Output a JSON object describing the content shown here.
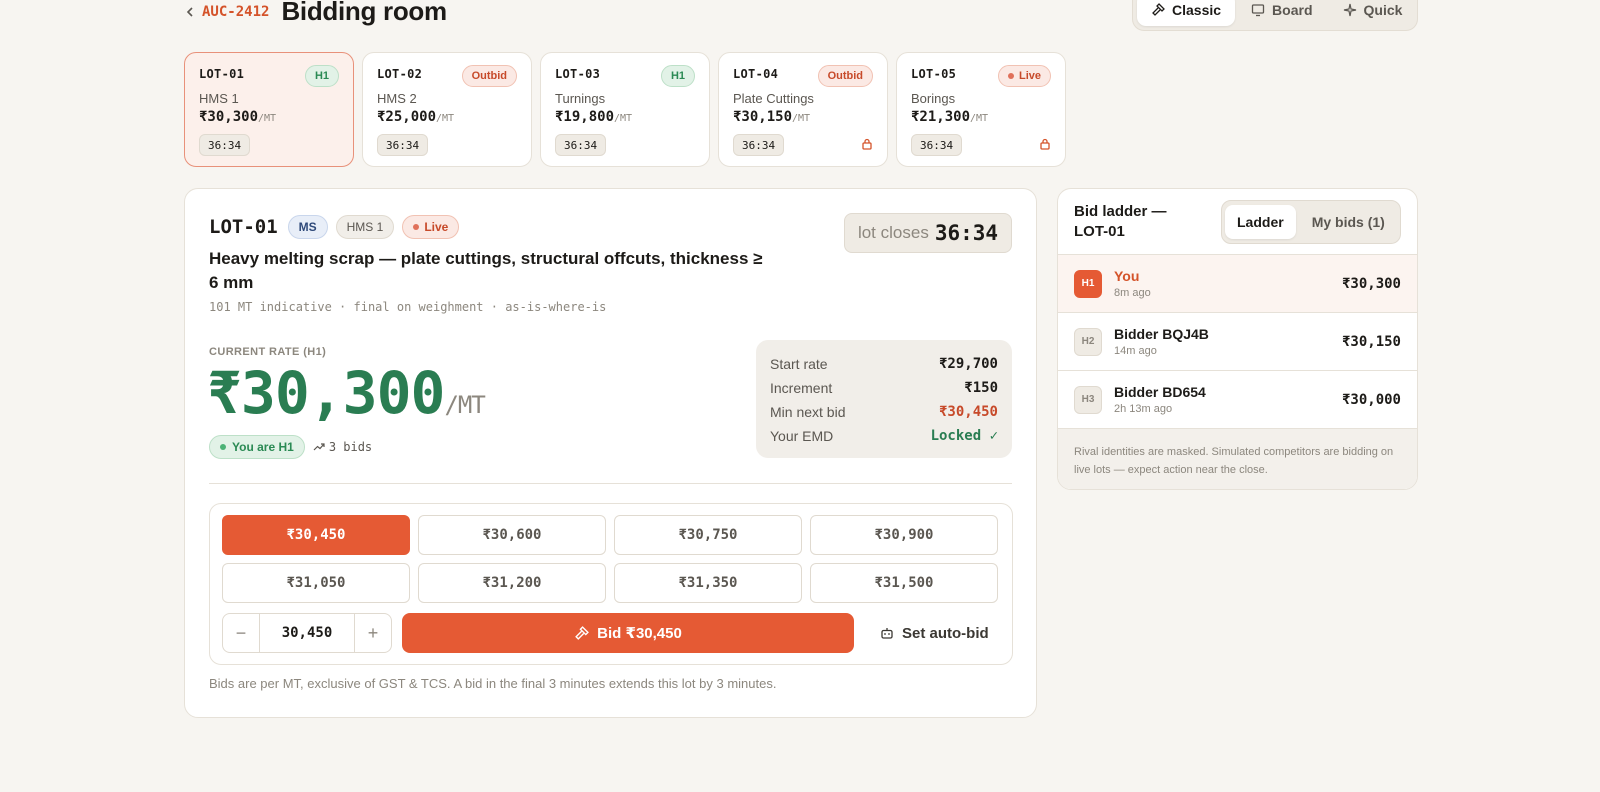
{
  "header": {
    "auction_id": "AUC-2412",
    "title": "Bidding room"
  },
  "modes": [
    {
      "label": "Classic",
      "icon": "gavel-icon",
      "active": true
    },
    {
      "label": "Board",
      "icon": "monitor-icon",
      "active": false
    },
    {
      "label": "Quick",
      "icon": "sparkle-icon",
      "active": false
    }
  ],
  "lots": [
    {
      "id": "LOT-01",
      "badge": "H1",
      "name": "HMS 1",
      "price": "₹30,300",
      "unit": "/MT",
      "timer": "36:34"
    },
    {
      "id": "LOT-02",
      "badge": "Outbid",
      "name": "HMS 2",
      "price": "₹25,000",
      "unit": "/MT",
      "timer": "36:34"
    },
    {
      "id": "LOT-03",
      "badge": "H1",
      "name": "Turnings",
      "price": "₹19,800",
      "unit": "/MT",
      "timer": "36:34"
    },
    {
      "id": "LOT-04",
      "badge": "Outbid",
      "name": "Plate Cuttings",
      "price": "₹30,150",
      "unit": "/MT",
      "timer": "36:34"
    },
    {
      "id": "LOT-05",
      "badge": "Live",
      "name": "Borings",
      "price": "₹21,300",
      "unit": "/MT",
      "timer": "36:34"
    }
  ],
  "main": {
    "lot_id": "LOT-01",
    "tag_ms": "MS",
    "tag_grade": "HMS 1",
    "tag_status": "Live",
    "closes_label": "lot closes",
    "closes_time": "36:34",
    "description": "Heavy melting scrap — plate cuttings, structural offcuts, thickness ≥ 6 mm",
    "sub": "101 MT indicative · final on weighment · as-is-where-is",
    "current_label": "CURRENT RATE (H1)",
    "current_rate": "₹30,300",
    "unit": "/MT",
    "you_h1": "You are H1",
    "bids_count": "3 bids",
    "stats": [
      {
        "label": "Start rate",
        "value": "₹29,700"
      },
      {
        "label": "Increment",
        "value": "₹150"
      },
      {
        "label": "Min next bid",
        "value": "₹30,450"
      },
      {
        "label": "Your EMD",
        "value": "Locked ✓"
      }
    ],
    "options": [
      "₹30,450",
      "₹30,600",
      "₹30,750",
      "₹30,900",
      "₹31,050",
      "₹31,200",
      "₹31,350",
      "₹31,500"
    ],
    "stepper_value": "30,450",
    "bid_button": "Bid ₹30,450",
    "auto_bid": "Set auto-bid",
    "footnote": "Bids are per MT, exclusive of GST & TCS. A bid in the final 3 minutes extends this lot by 3 minutes."
  },
  "ladder": {
    "title": "Bid ladder — LOT-01",
    "tabs": [
      "Ladder",
      "My bids (1)"
    ],
    "rows": [
      {
        "rank": "H1",
        "name": "You",
        "ago": "8m ago",
        "amount": "₹30,300"
      },
      {
        "rank": "H2",
        "name": "Bidder BQJ4B",
        "ago": "14m ago",
        "amount": "₹30,150"
      },
      {
        "rank": "H3",
        "name": "Bidder BD654",
        "ago": "2h 13m ago",
        "amount": "₹30,000"
      }
    ],
    "note": "Rival identities are masked. Simulated competitors are bidding on live lots — expect action near the close."
  },
  "colors": {
    "accent": "#e55a34",
    "green": "#2a7d52",
    "warn": "#c74a2a"
  }
}
